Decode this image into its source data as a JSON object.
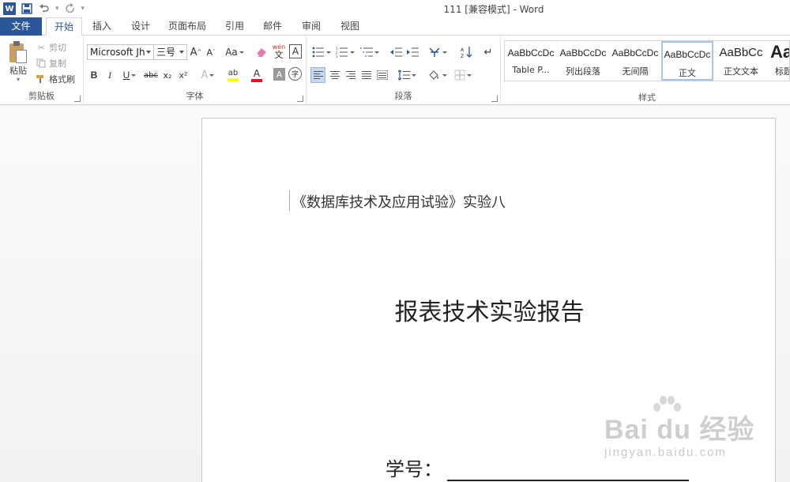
{
  "window": {
    "title": "111 [兼容模式] - Word",
    "app_logo_letter": "W"
  },
  "quick_access": {
    "icons": [
      "save-icon",
      "undo-icon",
      "redo-icon",
      "customize-icon"
    ]
  },
  "tabs": [
    {
      "label": "文件"
    },
    {
      "label": "开始"
    },
    {
      "label": "插入"
    },
    {
      "label": "设计"
    },
    {
      "label": "页面布局"
    },
    {
      "label": "引用"
    },
    {
      "label": "邮件"
    },
    {
      "label": "审阅"
    },
    {
      "label": "视图"
    }
  ],
  "ribbon": {
    "clipboard": {
      "label": "剪贴板",
      "paste": "粘贴",
      "cut": "剪切",
      "copy": "复制",
      "format_painter": "格式刷"
    },
    "font": {
      "label": "字体",
      "font_name": "Microsoft Jh",
      "font_size": "三号",
      "grow": "A",
      "shrink": "A",
      "change_case": "Aa",
      "pinyin_top": "wén",
      "pinyin_bottom": "文",
      "char_border": "A",
      "bold": "B",
      "italic": "I",
      "underline": "U",
      "strike": "abc",
      "subscript": "x₂",
      "superscript": "x²",
      "text_effect": "A",
      "highlight": "ab",
      "font_color": "A",
      "char_shading": "A",
      "enclose": "字",
      "font_color_hex": "#e81123",
      "highlight_hex": "#ffff00"
    },
    "paragraph": {
      "label": "段落"
    },
    "styles": {
      "label": "样式",
      "items": [
        {
          "sample": "AaBbCcDc",
          "name": "Table P..."
        },
        {
          "sample": "AaBbCcDc",
          "name": "列出段落"
        },
        {
          "sample": "AaBbCcDc",
          "name": "无间隔"
        },
        {
          "sample": "AaBbCcDc",
          "name": "正文"
        },
        {
          "sample": "AaBbCc",
          "name": "正文文本"
        },
        {
          "sample": "Aa",
          "name": "标题"
        }
      ],
      "selected_index": 3
    }
  },
  "document": {
    "header_text": "《数据库技术及应用试验》实验八",
    "title": "报表技术实验报告",
    "student_id_label": "学号："
  },
  "watermark": {
    "main": "Bai du 经验",
    "sub": "jingyan.baidu.com"
  },
  "colors": {
    "accent": "#2b579a"
  }
}
